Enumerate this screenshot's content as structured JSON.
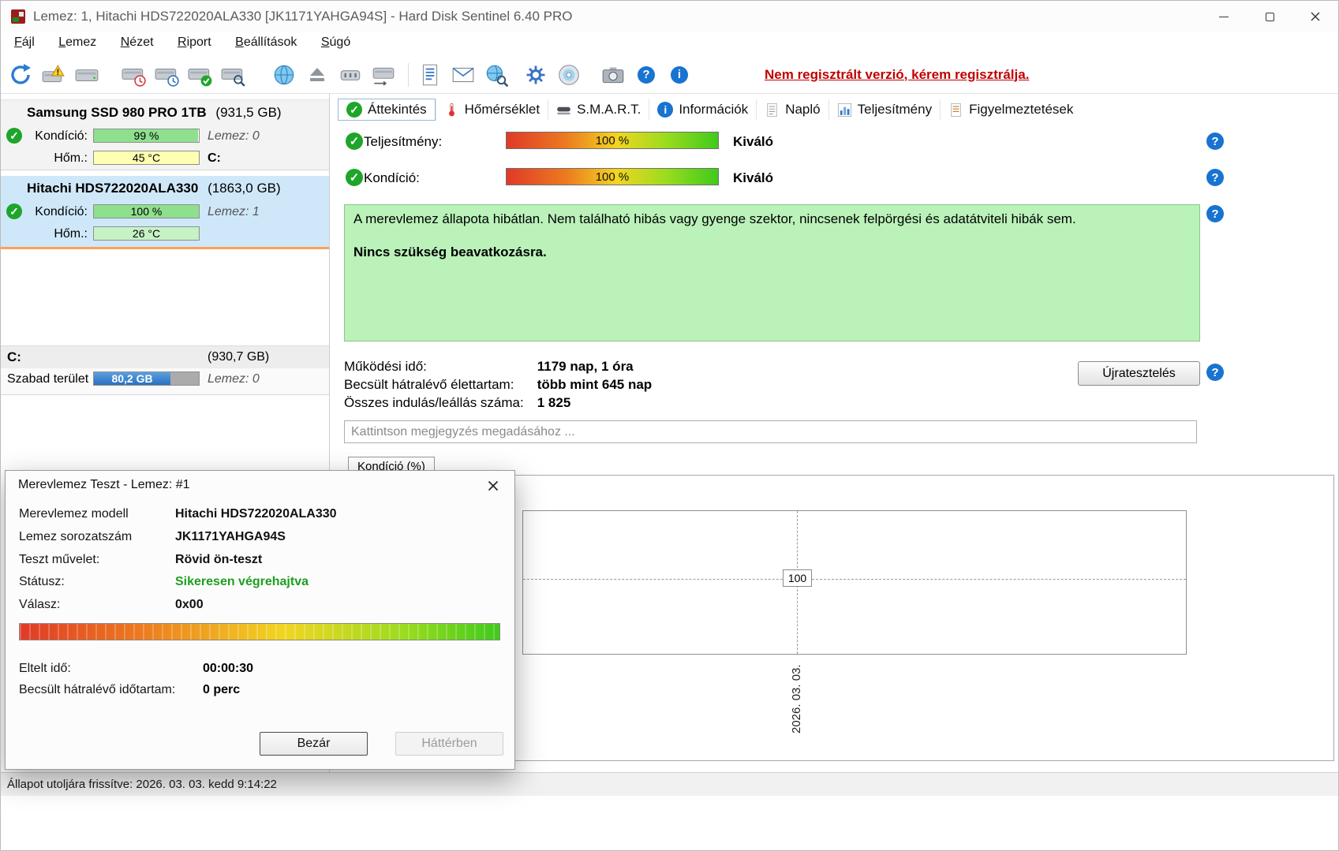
{
  "colors": {
    "selection_bg": "#cfe8f9",
    "selection_underline": "#ffa054",
    "status_green_bg": "#baf2ba",
    "register_red": "#c00000",
    "ok_green": "#1ea52a",
    "free_space_blue": "#2a6fc0"
  },
  "window": {
    "title": "Lemez: 1, Hitachi HDS722020ALA330 [JK1171YAHGA94S]  -  Hard Disk Sentinel 6.40 PRO"
  },
  "menu": {
    "items": [
      "Fájl",
      "Lemez",
      "Nézet",
      "Riport",
      "Beállítások",
      "Súgó"
    ]
  },
  "toolbar": {
    "register_notice": "Nem regisztrált verzió, kérem regisztrálja."
  },
  "sidebar": {
    "disks": [
      {
        "name": "Samsung SSD 980 PRO 1TB",
        "size": "(931,5 GB)",
        "condition_label": "Kondíció:",
        "condition_value": "99 %",
        "condition_percent": 99,
        "disk_index": "Lemez: 0",
        "temp_label": "Hőm.:",
        "temp_value": "45 °C",
        "drive_letter": "C:"
      },
      {
        "name": "Hitachi HDS722020ALA330",
        "size": "(1863,0 GB)",
        "condition_label": "Kondíció:",
        "condition_value": "100 %",
        "condition_percent": 100,
        "disk_index": "Lemez: 1",
        "temp_label": "Hőm.:",
        "temp_value": "26 °C"
      }
    ],
    "partition": {
      "name": "C:",
      "size": "(930,7 GB)",
      "free_label": "Szabad terület",
      "free_value": "80,2 GB",
      "disk_index": "Lemez: 0"
    }
  },
  "tabs": {
    "items": [
      "Áttekintés",
      "Hőmérséklet",
      "S.M.A.R.T.",
      "Információk",
      "Napló",
      "Teljesítmény",
      "Figyelmeztetések"
    ],
    "selected": "Áttekintés"
  },
  "overview": {
    "performance": {
      "label": "Teljesítmény:",
      "value": "100 %",
      "rating": "Kiváló"
    },
    "condition": {
      "label": "Kondíció:",
      "value": "100 %",
      "rating": "Kiváló"
    },
    "status_text": "A merevlemez állapota hibátlan. Nem található hibás vagy gyenge szektor, nincsenek felpörgési és adatátviteli hibák sem.",
    "status_action": "Nincs szükség beavatkozásra.",
    "power_on_label": "Működési idő:",
    "power_on_value": "1179 nap, 1 óra",
    "lifetime_label": "Becsült hátralévő élettartam:",
    "lifetime_value": "több mint 645 nap",
    "starts_label": "Összes indulás/leállás száma:",
    "starts_value": "1 825",
    "retest_button": "Újratesztelés",
    "comment_placeholder": "Kattintson megjegyzés megadásához ..."
  },
  "chart_data": {
    "type": "line",
    "title": "Kondíció  (%)",
    "x": [
      "2026. 03. 03."
    ],
    "values": [
      100
    ],
    "point_label": "100",
    "ylim": [
      0,
      100
    ],
    "grid": "dashed",
    "note": "condition history, single visible point at 100%"
  },
  "dialog": {
    "title": "Merevlemez Teszt - Lemez: #1",
    "model_label": "Merevlemez modell",
    "model_value": "Hitachi HDS722020ALA330",
    "serial_label": "Lemez sorozatszám",
    "serial_value": "JK1171YAHGA94S",
    "operation_label": "Teszt művelet:",
    "operation_value": "Rövid ön-teszt",
    "status_label": "Státusz:",
    "status_value": "Sikeresen végrehajtva",
    "response_label": "Válasz:",
    "response_value": "0x00",
    "elapsed_label": "Eltelt idő:",
    "elapsed_value": "00:00:30",
    "remaining_label": "Becsült hátralévő időtartam:",
    "remaining_value": "0 perc",
    "close_button": "Bezár",
    "background_button": "Háttérben"
  },
  "statusbar": {
    "text": "Állapot utoljára frissítve: 2026. 03. 03. kedd 9:14:22"
  }
}
